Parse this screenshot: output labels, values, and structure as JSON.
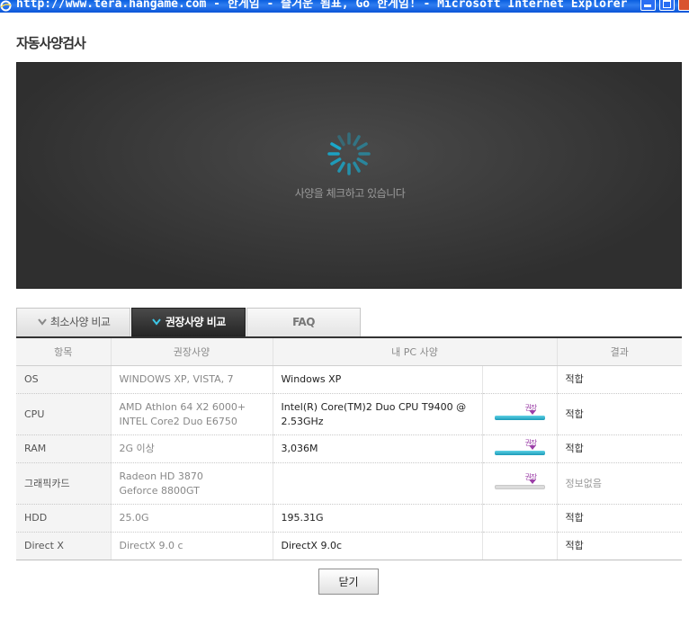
{
  "window": {
    "title": "http://www.tera.hangame.com - 한게임 - 즐거운 됨표, Go 한게임! - Microsoft Internet Explorer"
  },
  "page_title": "자동사양검사",
  "status": {
    "text": "사양을 체크하고 있습니다"
  },
  "tabs": [
    {
      "label": "최소사양 비교",
      "active": false
    },
    {
      "label": "권장사양 비교",
      "active": true
    },
    {
      "label": "FAQ",
      "active": false
    }
  ],
  "table": {
    "headers": {
      "item": "항목",
      "required": "권장사양",
      "mine": "내 PC 사양",
      "result": "결과"
    },
    "rows": [
      {
        "item": "OS",
        "required": [
          "WINDOWS XP, VISTA, 7"
        ],
        "mine": [
          "Windows XP"
        ],
        "gauge": null,
        "result": "적합"
      },
      {
        "item": "CPU",
        "required": [
          "AMD Athlon 64 X2 6000+",
          "INTEL Core2 Duo E6750"
        ],
        "mine": [
          "Intel(R) Core(TM)2 Duo CPU T9400 @",
          "2.53GHz"
        ],
        "gauge": {
          "label": "권장",
          "level": 1.0
        },
        "result": "적합"
      },
      {
        "item": "RAM",
        "required": [
          "2G 이상"
        ],
        "mine": [
          "3,036M"
        ],
        "gauge": {
          "label": "권장",
          "level": 1.0
        },
        "result": "적합"
      },
      {
        "item": "그래픽카드",
        "required": [
          "Radeon HD 3870",
          "Geforce 8800GT"
        ],
        "mine": [],
        "gauge": {
          "label": "권장",
          "level": 0
        },
        "result": "정보없음"
      },
      {
        "item": "HDD",
        "required": [
          "25.0G"
        ],
        "mine": [
          "195.31G"
        ],
        "gauge": null,
        "result": "적합"
      },
      {
        "item": "Direct X",
        "required": [
          "DirectX 9.0 c"
        ],
        "mine": [
          "DirectX 9.0c"
        ],
        "gauge": null,
        "result": "적합"
      }
    ]
  },
  "close_button": {
    "label": "닫기"
  },
  "colors": {
    "panel_bg": "#3a3a3a",
    "spinner": "#1aa7c9",
    "gauge_fill": "#1b9ab8",
    "gauge_label": "#9c3fa8"
  }
}
